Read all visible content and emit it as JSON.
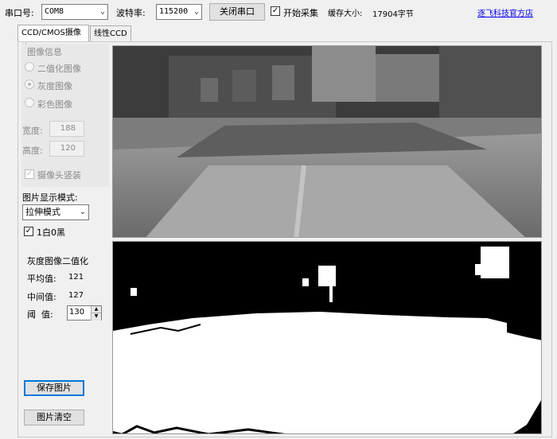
{
  "toolbar": {
    "port_label": "串口号:",
    "port_value": "COM8",
    "baud_label": "波特率:",
    "baud_value": "115200",
    "close_port_button": "关闭串口",
    "start_capture_checked": true,
    "start_capture_label": "开始采集",
    "buffer_label": "缓存大小:",
    "buffer_value": "17904字节",
    "shop_link": "逐飞科技官方店"
  },
  "tabs": [
    {
      "label": "CCD/CMOS摄像头",
      "active": true
    },
    {
      "label": "线性CCD",
      "active": false
    }
  ],
  "image_info": {
    "title": "图像信息",
    "modes": [
      {
        "label": "二值化图像",
        "selected": false
      },
      {
        "label": "灰度图像",
        "selected": true
      },
      {
        "label": "彩色图像",
        "selected": false
      }
    ],
    "width_label": "宽度:",
    "width_value": "188",
    "height_label": "高度:",
    "height_value": "120",
    "vertical_mount_label": "摄像头竖装",
    "vertical_mount_checked": true
  },
  "display": {
    "mode_label": "图片显示模式:",
    "mode_value": "拉伸模式",
    "one_white_label": "1白0黑",
    "one_white_checked": true
  },
  "binarize": {
    "title": "灰度图像二值化",
    "mean_label": "平均值:",
    "mean_value": "121",
    "median_label": "中间值:",
    "median_value": "127",
    "threshold_label": "阈  值:",
    "threshold_value": "130"
  },
  "buttons": {
    "save_image": "保存图片",
    "clear_image": "图片清空"
  },
  "colors": {
    "link": "#0000ee",
    "window_bg": "#f0f0f0",
    "focus_border": "#0078d7"
  }
}
